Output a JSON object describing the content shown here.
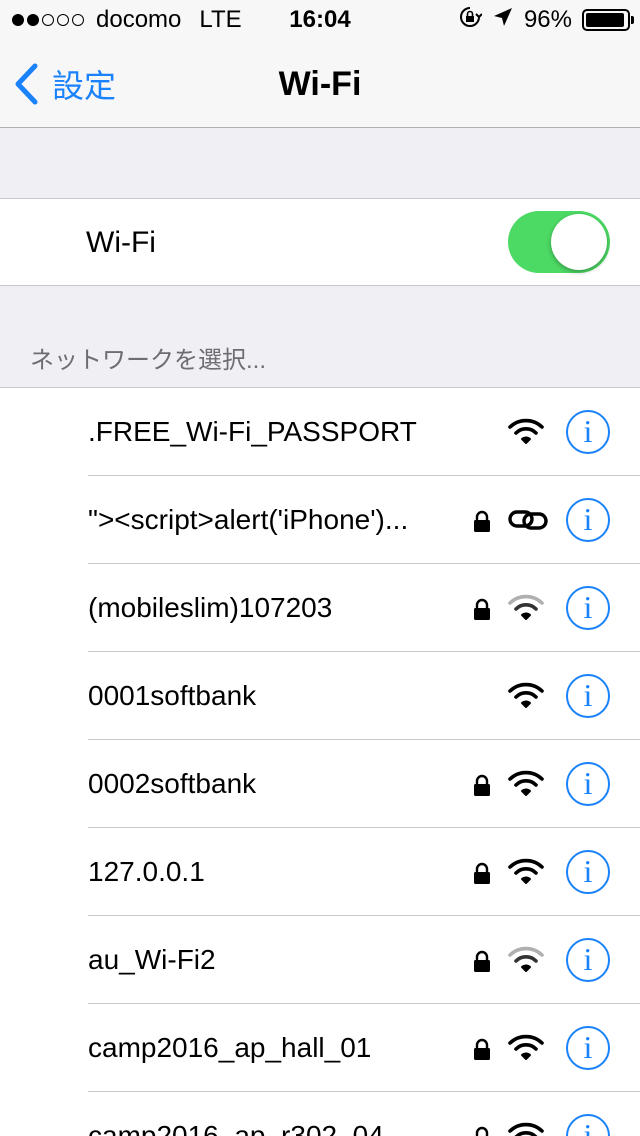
{
  "status_bar": {
    "carrier": "docomo",
    "network_type": "LTE",
    "time": "16:04",
    "battery_percent": "96%",
    "battery_level": 0.96,
    "signal_bars_filled": 2,
    "signal_bars_total": 5
  },
  "nav": {
    "back_label": "設定",
    "title": "Wi-Fi"
  },
  "wifi_toggle": {
    "label": "Wi-Fi",
    "on": true,
    "on_color": "#4cd964"
  },
  "section_header": "ネットワークを選択...",
  "networks": [
    {
      "name": ".FREE_Wi-Fi_PASSPORT",
      "locked": false,
      "icon": "wifi-strong-icon"
    },
    {
      "name": "\"><script>alert('iPhone')...",
      "locked": true,
      "icon": "personal-hotspot-link-icon"
    },
    {
      "name": "(mobileslim)107203",
      "locked": true,
      "icon": "wifi-weak-icon"
    },
    {
      "name": "0001softbank",
      "locked": false,
      "icon": "wifi-strong-icon"
    },
    {
      "name": "0002softbank",
      "locked": true,
      "icon": "wifi-strong-icon"
    },
    {
      "name": "127.0.0.1",
      "locked": true,
      "icon": "wifi-strong-icon"
    },
    {
      "name": "au_Wi-Fi2",
      "locked": true,
      "icon": "wifi-weak-icon"
    },
    {
      "name": "camp2016_ap_hall_01",
      "locked": true,
      "icon": "wifi-strong-icon"
    },
    {
      "name": "camp2016_ap_r302_04",
      "locked": true,
      "icon": "wifi-strong-icon"
    }
  ],
  "info_glyph": "i",
  "accent_color": "#1a82fb"
}
